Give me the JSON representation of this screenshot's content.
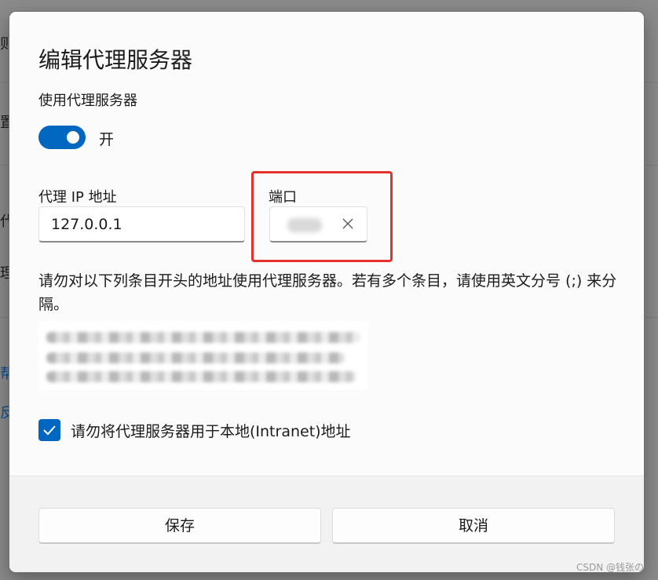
{
  "background": {
    "chars": [
      {
        "name": "bg-char-1",
        "text": "则",
        "link": false
      },
      {
        "name": "bg-char-2",
        "text": "置",
        "link": false
      },
      {
        "name": "bg-char-3",
        "text": "代",
        "link": false
      },
      {
        "name": "bg-char-4",
        "text": "理",
        "link": false
      },
      {
        "name": "bg-char-5",
        "text": "帮",
        "link": true
      },
      {
        "name": "bg-char-6",
        "text": "反",
        "link": true
      }
    ]
  },
  "dialog": {
    "title": "编辑代理服务器",
    "use_proxy_label": "使用代理服务器",
    "toggle_state_text": "开",
    "proxy_ip_label": "代理 IP 地址",
    "proxy_ip_value": "127.0.0.1",
    "port_label": "端口",
    "exceptions_instructions": "请勿对以下列条目开头的地址使用代理服务器。若有多个条目，请使用英文分号 (;) 来分隔。",
    "bypass_local_label": "请勿将代理服务器用于本地(Intranet)地址",
    "save_label": "保存",
    "cancel_label": "取消"
  },
  "watermark": "CSDN @钱张の",
  "colors": {
    "accent": "#0067c0",
    "highlight_border": "#e5312c"
  }
}
